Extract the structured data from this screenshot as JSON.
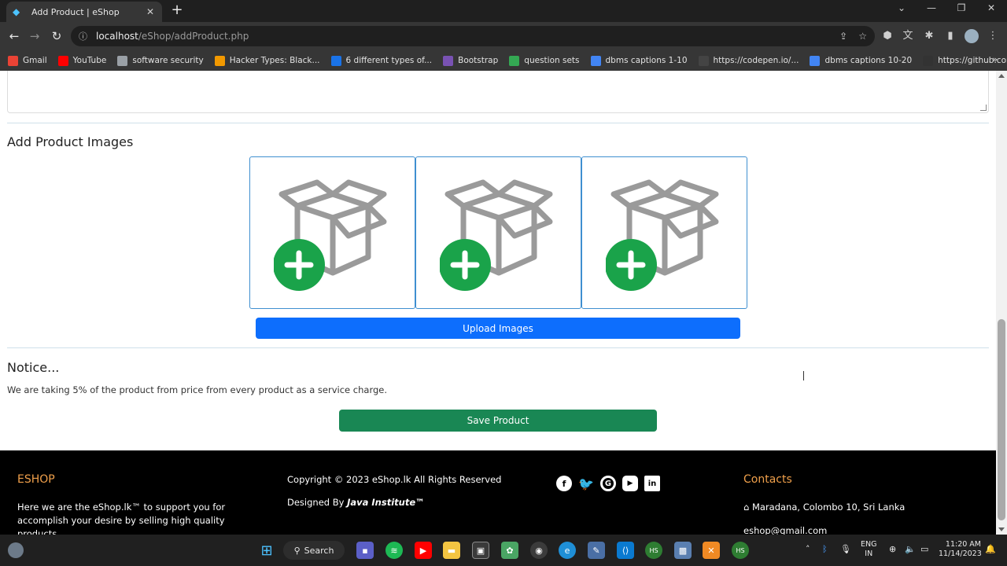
{
  "browser": {
    "tab_title": "Add Product | eShop",
    "url_host": "localhost",
    "url_path": "/eShop/addProduct.php",
    "bookmarks": [
      {
        "label": "Gmail",
        "color": "#ea4335"
      },
      {
        "label": "YouTube",
        "color": "#ff0000"
      },
      {
        "label": "software security",
        "color": "#9aa0a6"
      },
      {
        "label": "Hacker Types: Black...",
        "color": "#f29900"
      },
      {
        "label": "6 different types of...",
        "color": "#1a73e8"
      },
      {
        "label": "Bootstrap",
        "color": "#7952b3"
      },
      {
        "label": "question sets",
        "color": "#34a853"
      },
      {
        "label": "dbms captions 1-10",
        "color": "#4285f4"
      },
      {
        "label": "https://codepen.io/...",
        "color": "#444444"
      },
      {
        "label": "dbms captions 10-20",
        "color": "#4285f4"
      },
      {
        "label": "https://github.com/",
        "color": "#333333"
      }
    ]
  },
  "page": {
    "images_heading": "Add Product Images",
    "upload_label": "Upload Images",
    "notice_heading": "Notice...",
    "notice_text": "We are taking 5% of the product from price from every product as a service charge.",
    "save_label": "Save Product",
    "accent_blue": "#0d6efd",
    "accent_green": "#198754"
  },
  "footer": {
    "brand": "ESHOP",
    "description": "Here we are the eShop.lk™ to support you for accomplish your desire by selling high quality products",
    "copyright": "Copyright © 2023 eShop.lk All Rights Reserved",
    "designed_by_prefix": "Designed By",
    "designed_by_name": "Java Institute™",
    "contacts_heading": "Contacts",
    "address": "Maradana, Colombo 10, Sri Lanka",
    "email": "eshop@gmail.com",
    "socials": [
      "facebook-icon",
      "twitter-icon",
      "google-icon",
      "youtube-icon",
      "linkedin-icon"
    ]
  },
  "taskbar": {
    "search_label": "Search",
    "lang_top": "ENG",
    "lang_bottom": "IN",
    "time": "11:20 AM",
    "date": "11/14/2023"
  }
}
